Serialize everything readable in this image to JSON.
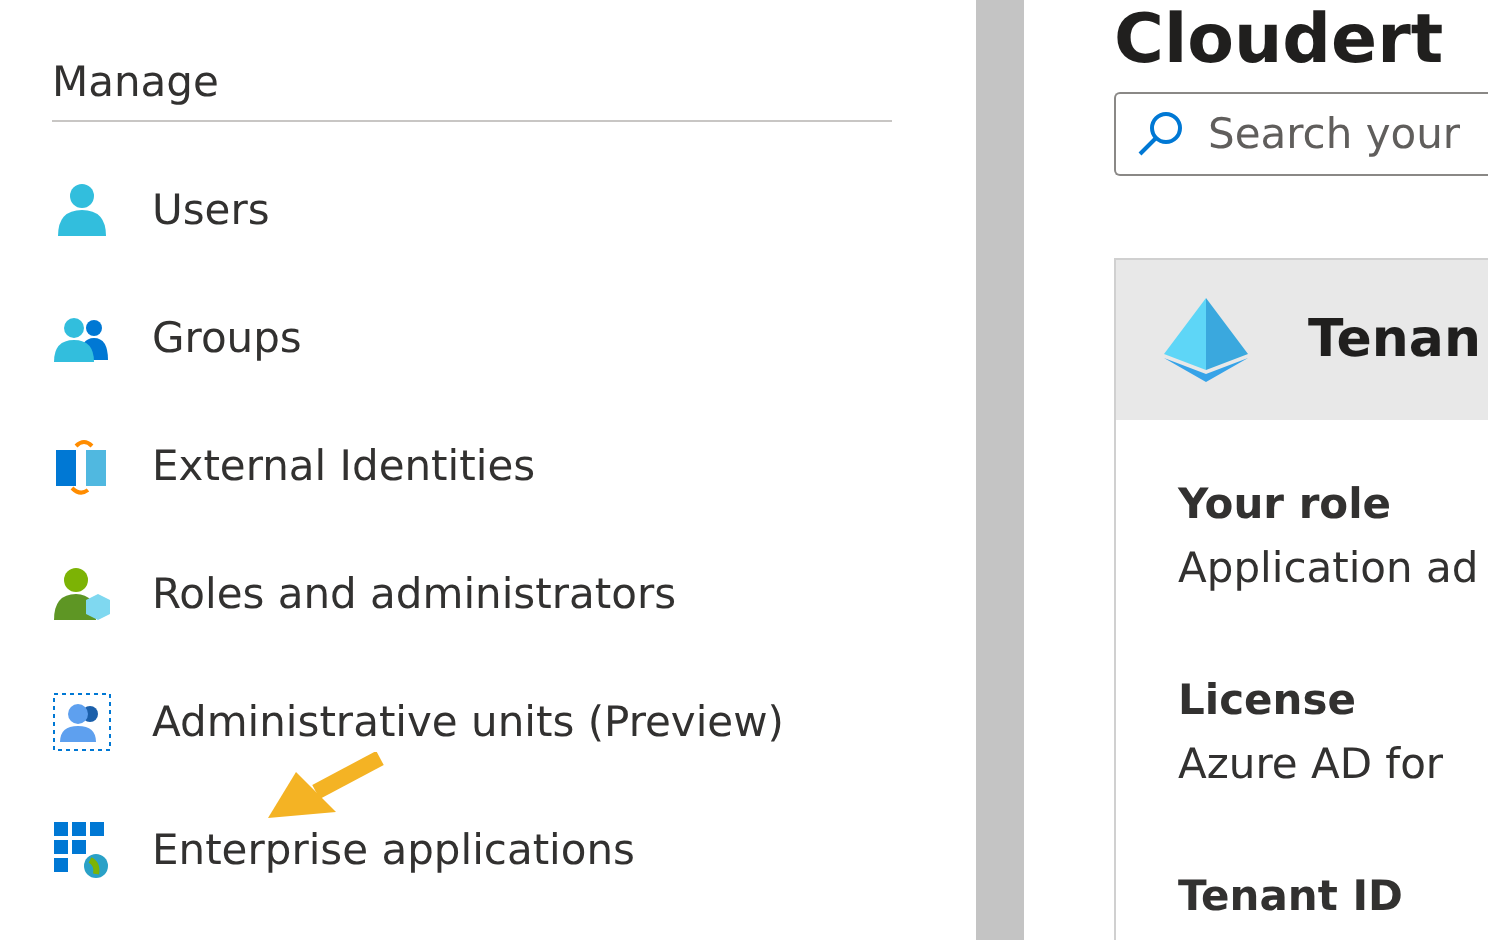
{
  "sidebar": {
    "section_title": "Manage",
    "items": [
      {
        "label": "Users",
        "kind": "user"
      },
      {
        "label": "Groups",
        "kind": "group"
      },
      {
        "label": "External Identities",
        "kind": "external"
      },
      {
        "label": "Roles and administrators",
        "kind": "roles"
      },
      {
        "label": "Administrative units (Preview)",
        "kind": "units"
      },
      {
        "label": "Enterprise applications",
        "kind": "apps"
      }
    ]
  },
  "main": {
    "title": "Cloudert",
    "search": {
      "placeholder": "Search your"
    },
    "card": {
      "title": "Tenan",
      "fields": [
        {
          "label": "Your role",
          "value": "Application ad"
        },
        {
          "label": "License",
          "value": "Azure AD for"
        },
        {
          "label": "Tenant ID"
        }
      ]
    }
  }
}
